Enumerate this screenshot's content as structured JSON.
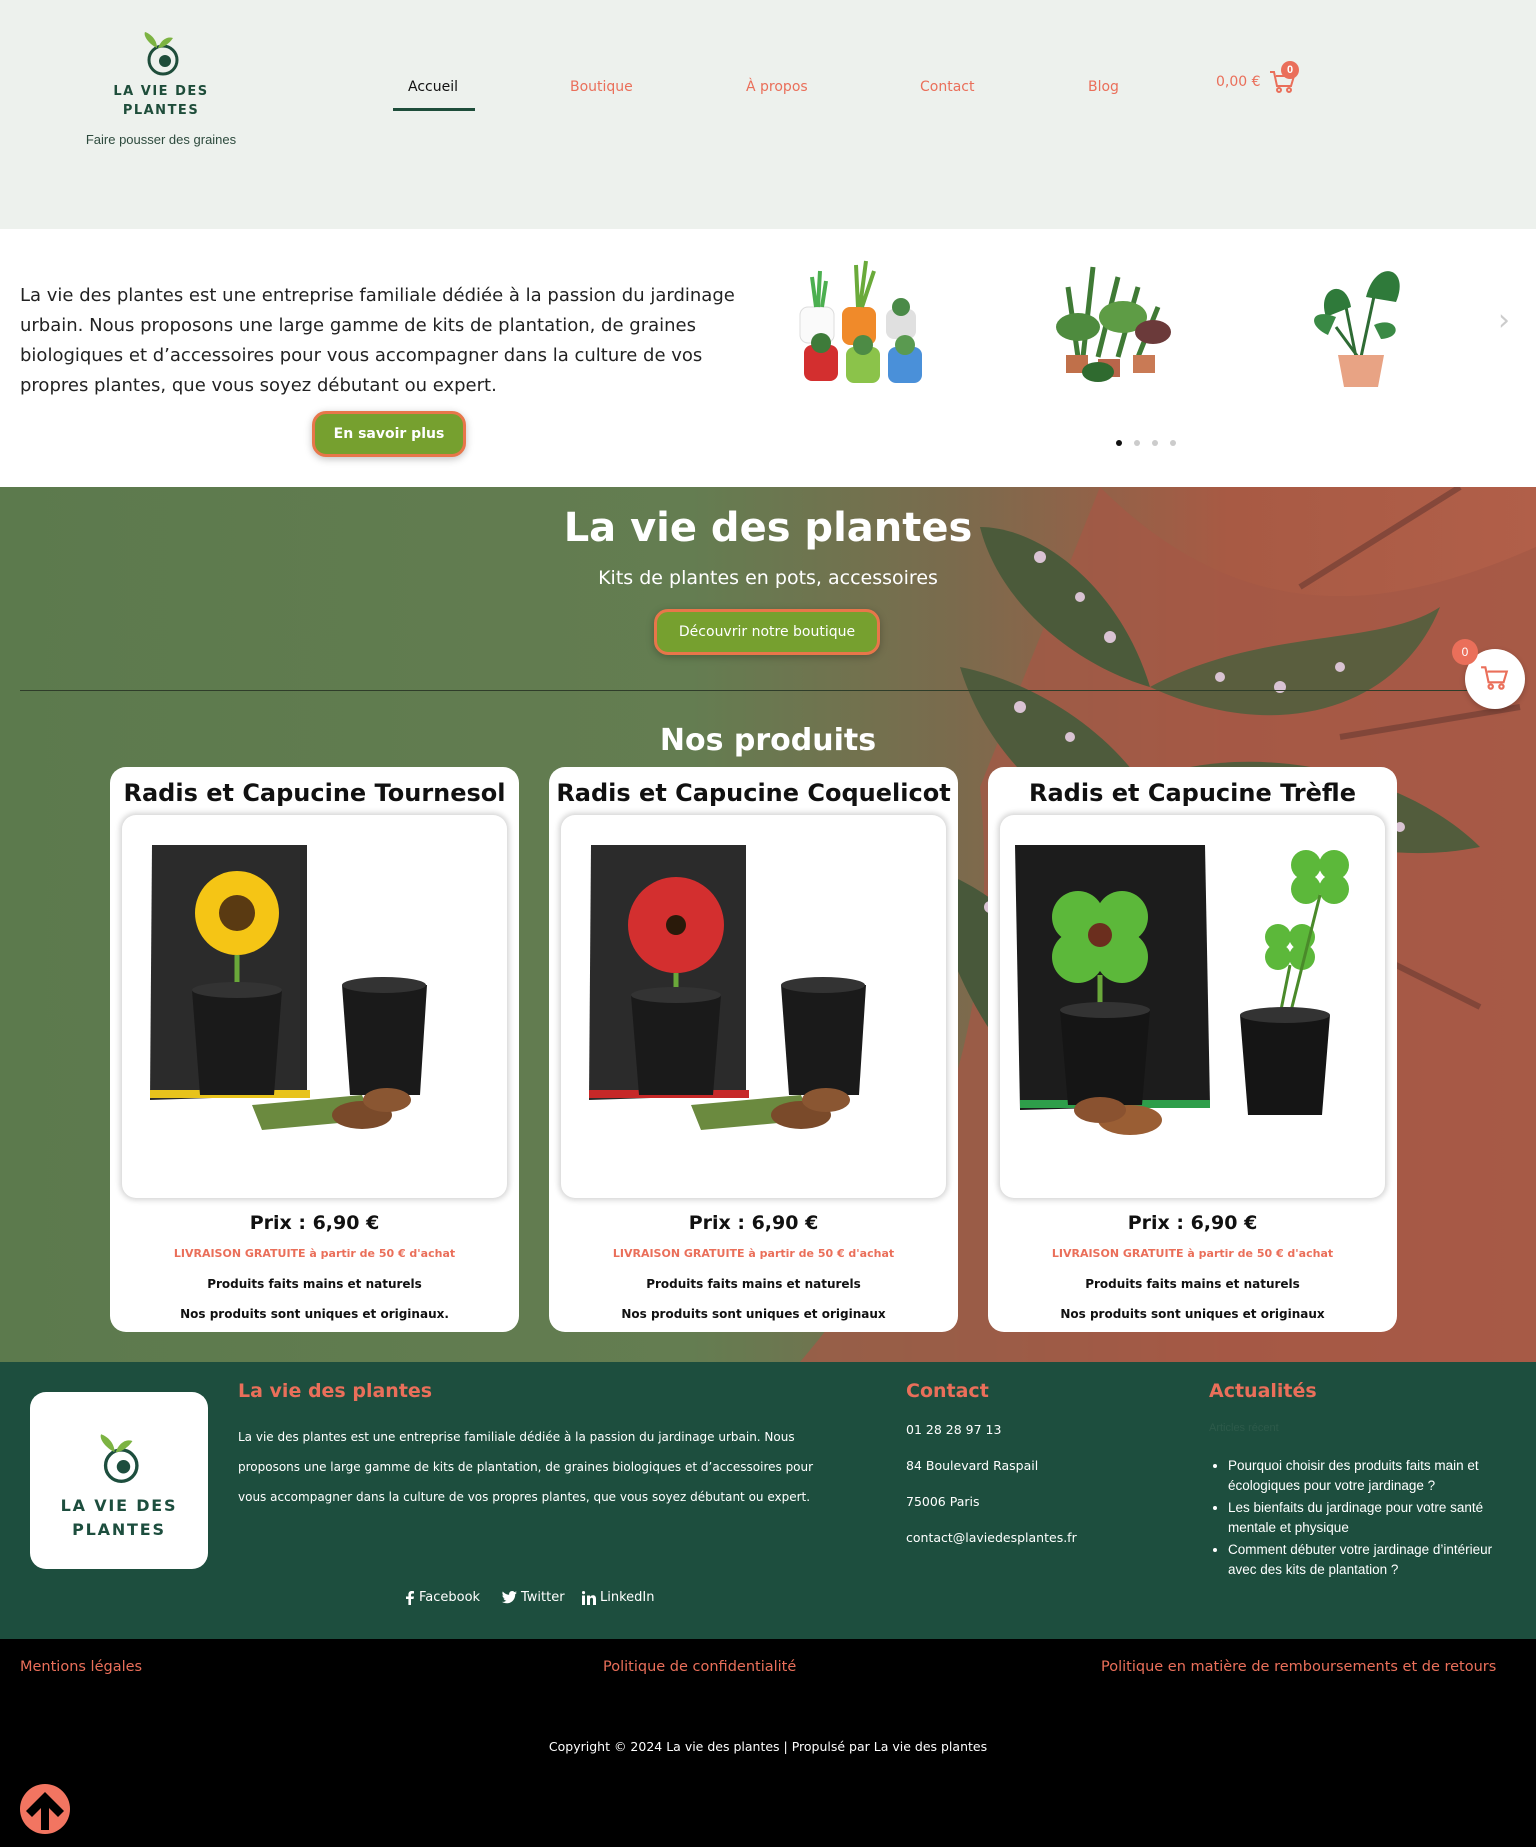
{
  "brand": {
    "name_line1": "LA VIE DES",
    "name_line2": "PLANTES",
    "tagline": "Faire pousser des graines"
  },
  "nav": {
    "items": [
      "Accueil",
      "Boutique",
      "À propos",
      "Contact",
      "Blog"
    ],
    "active": "Accueil"
  },
  "cart": {
    "total": "0,00 €",
    "count": "0",
    "floating_count": "0"
  },
  "intro": {
    "text": "La vie des plantes est une entreprise familiale dédiée à la passion du jardinage urbain. Nous proposons une large gamme de kits de plantation, de graines biologiques et d’accessoires pour vous accompagner dans la culture de vos propres plantes, que vous soyez débutant ou expert.",
    "button": "En savoir plus",
    "carousel_dots": 4,
    "carousel_active": 0
  },
  "hero": {
    "title": "La vie des plantes",
    "subtitle": "Kits de plantes en pots, accessoires",
    "button": "Découvrir notre boutique"
  },
  "products": {
    "title": "Nos produits",
    "items": [
      {
        "title": "Radis et Capucine Tournesol",
        "price": "Prix : 6,90 €",
        "shipping": "LIVRAISON GRATUITE à partir de 50 € d'achat",
        "line1": "Produits faits mains et naturels",
        "line2": "Nos produits sont uniques et originaux."
      },
      {
        "title": "Radis et Capucine Coquelicot",
        "price": "Prix : 6,90 €",
        "shipping": "LIVRAISON GRATUITE à partir de 50 € d'achat",
        "line1": "Produits faits mains et naturels",
        "line2": "Nos produits sont uniques et originaux"
      },
      {
        "title": "Radis et Capucine Trèfle",
        "price": "Prix : 6,90 €",
        "shipping": "LIVRAISON GRATUITE à partir de 50 € d'achat",
        "line1": "Produits faits mains et naturels",
        "line2": "Nos produits sont uniques et originaux"
      }
    ]
  },
  "footer": {
    "about_heading": "La vie des plantes",
    "about_text": "La vie des plantes est une entreprise familiale dédiée à la passion du jardinage urbain. Nous proposons une large gamme de kits de plantation, de graines biologiques et d’accessoires pour vous accompagner dans la culture de vos propres plantes, que vous soyez débutant ou expert.",
    "contact_heading": "Contact",
    "phone": "01 28 28 97 13",
    "address": "84 Boulevard Raspail",
    "city": "75006  Paris",
    "email": "contact@laviedesplantes.fr",
    "news_heading": "Actualités",
    "news_sub": "Articles récent",
    "news": [
      "Pourquoi choisir des produits faits main et écologiques pour votre jardinage ?",
      "Les bienfaits du jardinage pour votre santé mentale et physique",
      "Comment débuter votre jardinage d’intérieur avec des kits de plantation ?"
    ],
    "social": [
      "Facebook",
      "Twitter",
      "LinkedIn"
    ]
  },
  "bottom": {
    "legal": "Mentions légales",
    "privacy": "Politique de confidentialité",
    "refunds": "Politique en matière de remboursements et de retours",
    "copyright": "Copyright © 2024 La vie des plantes | Propulsé par La vie des plantes"
  },
  "colors": {
    "accent": "#ea6f5a",
    "brand_green": "#1d4e3e",
    "button_green": "#76a02f",
    "header_bg": "#edf1ed"
  },
  "icons": [
    "sprout-logo-icon",
    "cart-icon",
    "chevron-right-icon",
    "facebook-icon",
    "twitter-icon",
    "linkedin-icon",
    "arrow-up-icon"
  ]
}
